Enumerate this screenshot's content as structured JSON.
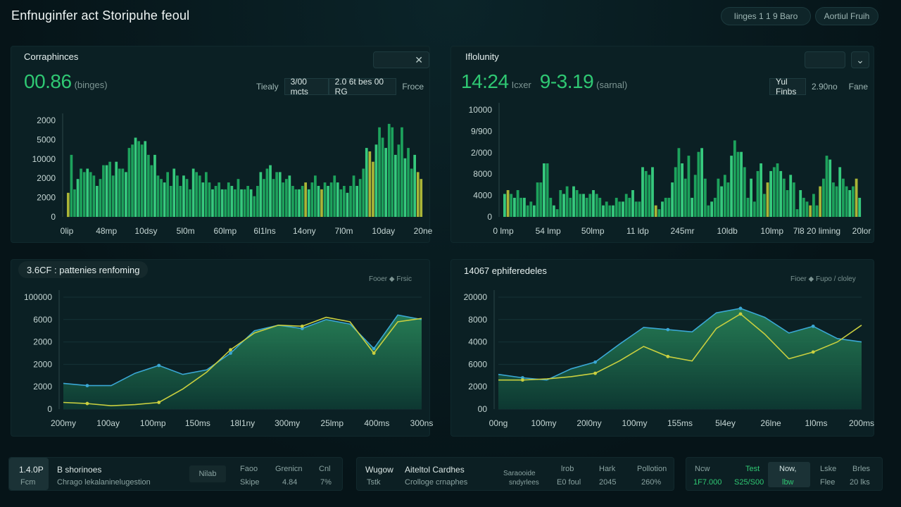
{
  "header": {
    "title": "Enfnuginfer act Storipuhe feoul",
    "pill1": "Iinges  1 1 9 Baro",
    "pill2": "Aortiul Fruih"
  },
  "panels": [
    {
      "title": "Corraphinces",
      "big": "00.86",
      "unit": "(binges)",
      "seg": [
        "Tiealy",
        "3/00 mcts",
        "2.0 6t bes 00 RG",
        "Froce"
      ],
      "seg_active": 1
    },
    {
      "title": "Iflolunity",
      "big": "14:24",
      "big_unit": "Icxer",
      "big2": "9-3.19",
      "unit": "(sarnal)",
      "seg": [
        "Yul Finbs",
        "2.90no",
        "Fane"
      ],
      "seg_active": 0
    },
    {
      "title": "3.6CF : pattenies renfoming",
      "legend": "Fooer  ◆  Frsic"
    },
    {
      "title": "14067 ephiferedeles",
      "legend": "Fioer  ◆  Fupo / cloley"
    }
  ],
  "colors": {
    "accent": "#2fc873",
    "bar": "#1fae62",
    "bar_hi": "#3bd886",
    "bar_yellow": "#b8c23a",
    "line_blue": "#3aa7d4",
    "line_yellow": "#c9cf3f",
    "area": "#1e6a4f"
  },
  "icons": {
    "close": "close-icon",
    "dropdown": "chevron-down-icon"
  },
  "chart_data": [
    {
      "type": "bar",
      "yticks": [
        "2000",
        "5000",
        "10000",
        "2000",
        "2000",
        "0"
      ],
      "xticks": [
        "0lip",
        "48mp",
        "10dsy",
        "5l0m",
        "60lmp",
        "6l1lns",
        "14ony",
        "7l0m",
        "10day",
        "20ne"
      ],
      "values": [
        7,
        18,
        8,
        11,
        14,
        13,
        14,
        13,
        12,
        9,
        11,
        15,
        15,
        16,
        12,
        16,
        14,
        14,
        13,
        20,
        21,
        23,
        22,
        21,
        22,
        18,
        15,
        18,
        12,
        11,
        10,
        13,
        9,
        14,
        12,
        9,
        12,
        11,
        8,
        14,
        13,
        12,
        10,
        13,
        10,
        8,
        9,
        10,
        8,
        8,
        10,
        9,
        8,
        11,
        8,
        8,
        9,
        8,
        6,
        9,
        13,
        11,
        14,
        15,
        11,
        13,
        13,
        10,
        11,
        12,
        9,
        8,
        8,
        9,
        10,
        8,
        10,
        12,
        9,
        8,
        10,
        9,
        10,
        12,
        10,
        8,
        9,
        7,
        9,
        12,
        9,
        11,
        14,
        20,
        19,
        16,
        21,
        26,
        23,
        20,
        27,
        26,
        18,
        21,
        26,
        17,
        20,
        14,
        18,
        13,
        11
      ],
      "yellow": [
        0,
        74,
        79,
        94,
        95,
        109,
        110
      ]
    },
    {
      "type": "bar",
      "yticks": [
        "10000",
        "9/900",
        "2/000",
        "8000",
        "4000",
        "0"
      ],
      "xticks": [
        "0 lmp",
        "54 lmp",
        "50lmp",
        "11 ldp",
        "245mr",
        "10ldb",
        "10lmp",
        "7l8 20 liming",
        "20lor"
      ],
      "values": [
        6,
        7,
        6,
        5,
        7,
        5,
        5,
        3,
        4,
        3,
        9,
        9,
        14,
        14,
        5,
        3,
        2,
        7,
        6,
        8,
        5,
        8,
        7,
        6,
        6,
        5,
        6,
        7,
        6,
        5,
        3,
        4,
        3,
        3,
        5,
        4,
        4,
        6,
        5,
        7,
        4,
        4,
        13,
        12,
        11,
        13,
        3,
        2,
        4,
        5,
        5,
        9,
        13,
        18,
        14,
        10,
        16,
        5,
        11,
        17,
        18,
        10,
        3,
        4,
        5,
        10,
        8,
        11,
        9,
        16,
        20,
        17,
        17,
        13,
        5,
        10,
        4,
        12,
        14,
        6,
        9,
        12,
        13,
        14,
        12,
        10,
        7,
        11,
        9,
        2,
        7,
        5,
        4,
        3,
        6,
        3,
        8,
        10,
        16,
        15,
        9,
        8,
        13,
        10,
        8,
        7,
        8,
        10,
        5
      ],
      "yellow": [
        1,
        46,
        80,
        93,
        96,
        107
      ]
    },
    {
      "type": "area",
      "yticks": [
        "100000",
        "6000",
        "2000",
        "2000",
        "2000",
        "0"
      ],
      "xticks": [
        "200my",
        "100ay",
        "100mp",
        "150ms",
        "18l1ny",
        "300my",
        "25lmp",
        "400ms",
        "300ns"
      ],
      "series": [
        {
          "name": "blue",
          "values": [
            2300,
            2100,
            2100,
            3200,
            3900,
            3100,
            3500,
            5000,
            7000,
            7500,
            7200,
            8000,
            7600,
            5400,
            8400,
            8000
          ]
        },
        {
          "name": "yellow",
          "values": [
            600,
            500,
            300,
            400,
            600,
            1800,
            3300,
            5300,
            6800,
            7500,
            7400,
            8200,
            7800,
            5000,
            7800,
            8100
          ]
        }
      ]
    },
    {
      "type": "area",
      "yticks": [
        "20000",
        "8000",
        "4000",
        "6000",
        "2000",
        "00"
      ],
      "xticks": [
        "00ng",
        "100my",
        "20l0ny",
        "100my",
        "155ms",
        "5l4ey",
        "26lne",
        "1l0ms",
        "200ms"
      ],
      "series": [
        {
          "name": "blue",
          "values": [
            3100,
            2800,
            2600,
            3600,
            4200,
            5800,
            7300,
            7100,
            6900,
            8600,
            9000,
            8200,
            6800,
            7400,
            6300,
            6000
          ]
        },
        {
          "name": "yellow",
          "values": [
            2600,
            2600,
            2700,
            2900,
            3200,
            4300,
            5600,
            4700,
            4300,
            7200,
            8500,
            6700,
            4500,
            5100,
            6000,
            7500
          ]
        }
      ]
    }
  ],
  "footer": [
    {
      "badge": "1.4.0P",
      "badge_sub": "Fcm",
      "title": "B shorinoes",
      "sub": "Chrago lekalaninelugestion",
      "cols": [
        [
          "Nilab",
          ""
        ],
        [
          "Faoo",
          "Skipe"
        ],
        [
          "Grenicn",
          "4.84"
        ],
        [
          "Cnl",
          "7%"
        ]
      ]
    },
    {
      "left": "Wugow",
      "left_sub": "Tstk",
      "title": "Aiteltol Cardhes",
      "sub": "Crolloge  crnaphes",
      "cols": [
        [
          "Saraooide",
          "sndyrlees"
        ],
        [
          "lrob",
          "E0 foul"
        ],
        [
          "Hark",
          "2045"
        ],
        [
          "Pollotion",
          "260%"
        ]
      ]
    },
    {
      "cols": [
        [
          "Ncw",
          "1F7.000"
        ],
        [
          "Test",
          "S25/S00"
        ],
        [
          "Now,",
          "lbw"
        ],
        [
          "Lske",
          "Flee"
        ],
        [
          "Brles",
          "20 lks"
        ]
      ]
    }
  ]
}
